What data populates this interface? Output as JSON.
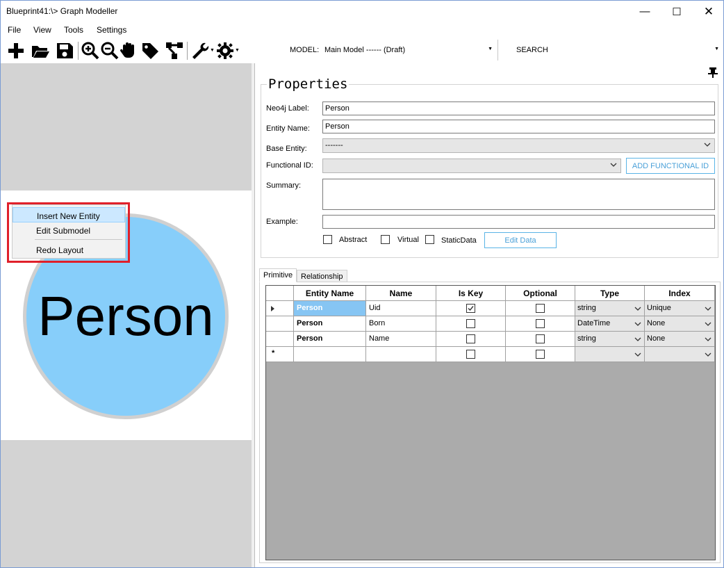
{
  "window": {
    "title": "Blueprint41:\\> Graph Modeller",
    "minimize": "—",
    "maximize": "☐",
    "close": "✕"
  },
  "menu": [
    "File",
    "View",
    "Tools",
    "Settings"
  ],
  "toolbar": {
    "icons": [
      "add-icon",
      "open-folder-icon",
      "save-icon",
      "zoom-in-icon",
      "zoom-out-icon",
      "hand-pan-icon",
      "tag-icon",
      "hierarchy-icon",
      "wrench-icon",
      "gear-icon"
    ],
    "model_label": "MODEL:",
    "model_value": "Main Model ------ (Draft)",
    "search_label": "SEARCH"
  },
  "canvas": {
    "node_label": "Person",
    "node_color": "#87cefa"
  },
  "context_menu": {
    "items": [
      "Insert New Entity",
      "Edit Submodel",
      "Redo Layout"
    ],
    "highlight_color": "#e0202a"
  },
  "properties": {
    "title": "Properties",
    "neo4j_label_caption": "Neo4j Label:",
    "neo4j_label_value": "Person",
    "entity_name_caption": "Entity Name:",
    "entity_name_value": "Person",
    "base_entity_caption": "Base Entity:",
    "base_entity_value": "-------",
    "functional_id_caption": "Functional ID:",
    "functional_id_value": "",
    "add_functional_id_button": "ADD FUNCTIONAL ID",
    "summary_caption": "Summary:",
    "summary_value": "",
    "example_caption": "Example:",
    "example_value": "",
    "abstract_label": "Abstract",
    "virtual_label": "Virtual",
    "staticdata_label": "StaticData",
    "edit_data_button": "Edit Data"
  },
  "tabs": [
    "Primitive",
    "Relationship"
  ],
  "grid": {
    "columns": [
      "Entity Name",
      "Name",
      "Is Key",
      "Optional",
      "Type",
      "Index"
    ],
    "rows": [
      {
        "entity": "Person",
        "name": "Uid",
        "is_key": true,
        "optional": false,
        "type": "string",
        "index": "Unique"
      },
      {
        "entity": "Person",
        "name": "Born",
        "is_key": false,
        "optional": false,
        "type": "DateTime",
        "index": "None"
      },
      {
        "entity": "Person",
        "name": "Name",
        "is_key": false,
        "optional": false,
        "type": "string",
        "index": "None"
      }
    ],
    "new_row_marker": "*"
  }
}
